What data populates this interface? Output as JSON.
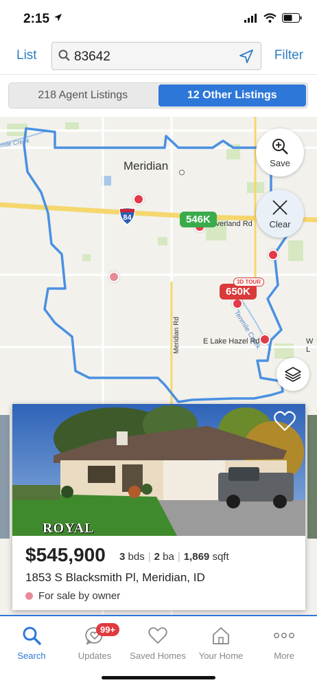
{
  "status_bar": {
    "time": "2:15"
  },
  "search": {
    "list_label": "List",
    "filter_label": "Filter",
    "query": "83642"
  },
  "segments": {
    "agent": "218 Agent Listings",
    "other": "12 Other Listings",
    "active": "other"
  },
  "map": {
    "city_label": "Meridian",
    "interstate": "84",
    "roads": {
      "overland": "Overland Rd",
      "tenmile": "Tenmile Creek",
      "lake_hazel": "E Lake Hazel Rd",
      "lake_hazel_w": "W L",
      "meridian_rd": "Meridian Rd",
      "creek_nw": "mile Creek"
    },
    "price_tags": [
      {
        "label": "546K",
        "color": "green"
      },
      {
        "label": "650K",
        "color": "red",
        "badge": "3D TOUR"
      }
    ],
    "save_label": "Save",
    "clear_label": "Clear"
  },
  "listing": {
    "price": "$545,900",
    "beds_value": "3",
    "beds_unit": "bds",
    "baths_value": "2",
    "baths_unit": "ba",
    "sqft_value": "1,869",
    "sqft_unit": "sqft",
    "address": "1853 S Blacksmith Pl, Meridian, ID",
    "status": "For sale by owner",
    "photo_watermark": "ROYAL"
  },
  "tabbar": {
    "items": [
      {
        "label": "Search",
        "icon": "search-icon"
      },
      {
        "label": "Updates",
        "icon": "heart-chat-icon"
      },
      {
        "label": "Saved Homes",
        "icon": "heart-icon"
      },
      {
        "label": "Your Home",
        "icon": "house-icon"
      },
      {
        "label": "More",
        "icon": "dots-icon"
      }
    ],
    "updates_badge": "99+",
    "active": "Search"
  },
  "colors": {
    "accent": "#2d77d9",
    "link": "#2f7ec2",
    "pin_red": "#e23a4a",
    "pin_pink": "#e98a98",
    "tag_green": "#3aab4b"
  }
}
